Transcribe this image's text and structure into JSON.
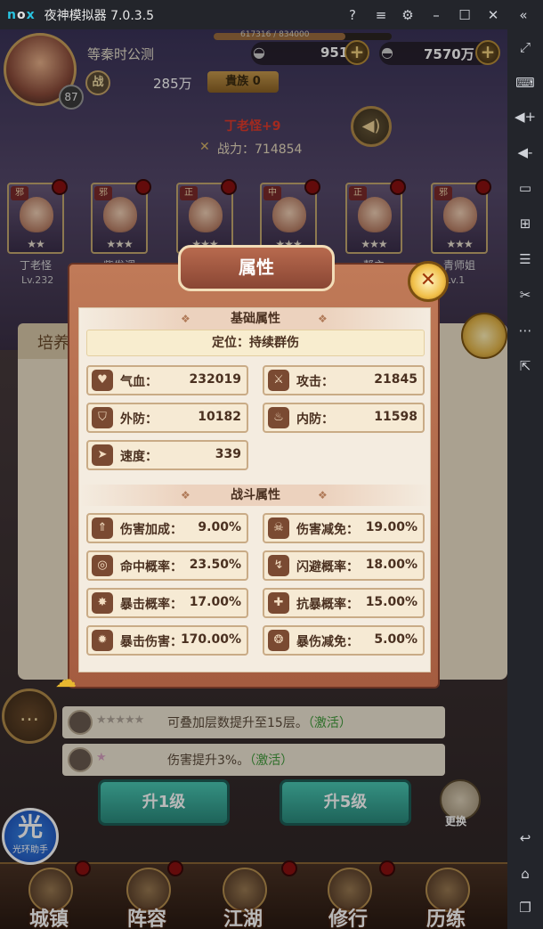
{
  "emulator": {
    "logo": "nox",
    "title": "夜神模拟器 7.0.3.5",
    "controls": [
      "help-icon",
      "menu-icon",
      "gear-icon",
      "minimize-icon",
      "maximize-icon",
      "close-icon",
      "collapse-icon"
    ],
    "sidebar_icons": [
      "fullscreen-icon",
      "keyboard-icon",
      "volume-up-icon",
      "volume-down-icon",
      "screen-icon",
      "apk-icon",
      "multi-instance-icon",
      "scissors-icon",
      "more-icon",
      "expand-icon",
      "back-icon",
      "home-icon",
      "recent-icon"
    ]
  },
  "header": {
    "avatar_level": "87",
    "vip_label": "等秦时公测",
    "exp_text": "617316 / 834000",
    "exp_fraction": 0.74,
    "silver": "951",
    "gold": "7570万",
    "power_badge": "战",
    "power": "285万",
    "noble": "貴族 0"
  },
  "hero": {
    "name": "丁老怪+9",
    "combat_label": "战力：714854"
  },
  "heroes": [
    {
      "tag": "邪",
      "stars": "★★",
      "name": "丁老怪",
      "level": "Lv.232"
    },
    {
      "tag": "邪",
      "stars": "★★★",
      "name": "紫发调",
      "level": ""
    },
    {
      "tag": "正",
      "stars": "★★★",
      "name": "",
      "level": ""
    },
    {
      "tag": "中",
      "stars": "★★★",
      "name": "",
      "level": ""
    },
    {
      "tag": "正",
      "stars": "★★★",
      "name": "帮主",
      "level": ""
    },
    {
      "tag": "邪",
      "stars": "★★★",
      "name": "青师姐",
      "level": "Lv.1"
    }
  ],
  "panel": {
    "tab_label": "培养",
    "skill_rows": [
      {
        "stars": "★★★★★",
        "text": "可叠加层数提升至15层。",
        "status": "（激活）"
      },
      {
        "stars": "★",
        "text": "伤害提升3%。",
        "status": "（激活）"
      }
    ],
    "upgrade_1": "升1级",
    "upgrade_5": "升5级",
    "swap_label": "更换"
  },
  "helper": {
    "char": "光",
    "label": "光环助手"
  },
  "nav": [
    {
      "label": "城镇"
    },
    {
      "label": "阵容"
    },
    {
      "label": "江湖"
    },
    {
      "label": "修行"
    },
    {
      "label": "历练"
    }
  ],
  "dialog": {
    "title": "属性",
    "basic_section": "基础属性",
    "role": "定位：持续群伤",
    "basic_stats": [
      {
        "name": "气血：",
        "value": "232019",
        "icon": "heart-icon"
      },
      {
        "name": "攻击：",
        "value": "21845",
        "icon": "sword-icon"
      },
      {
        "name": "外防：",
        "value": "10182",
        "icon": "shield-icon"
      },
      {
        "name": "内防：",
        "value": "11598",
        "icon": "flame-icon"
      },
      {
        "name": "速度：",
        "value": "339",
        "icon": "speed-icon"
      }
    ],
    "battle_section": "战斗属性",
    "battle_stats": [
      {
        "name": "伤害加成：",
        "value": "9.00%",
        "icon": "damage-up-icon"
      },
      {
        "name": "伤害减免：",
        "value": "19.00%",
        "icon": "skull-icon"
      },
      {
        "name": "命中概率：",
        "value": "23.50%",
        "icon": "target-icon"
      },
      {
        "name": "闪避概率：",
        "value": "18.00%",
        "icon": "dodge-icon"
      },
      {
        "name": "暴击概率：",
        "value": "17.00%",
        "icon": "crit-icon"
      },
      {
        "name": "抗暴概率：",
        "value": "15.00%",
        "icon": "anti-crit-icon"
      },
      {
        "name": "暴击伤害：",
        "value": "170.00%",
        "icon": "crit-damage-icon"
      },
      {
        "name": "暴伤减免：",
        "value": "5.00%",
        "icon": "crit-reduce-icon"
      }
    ]
  }
}
